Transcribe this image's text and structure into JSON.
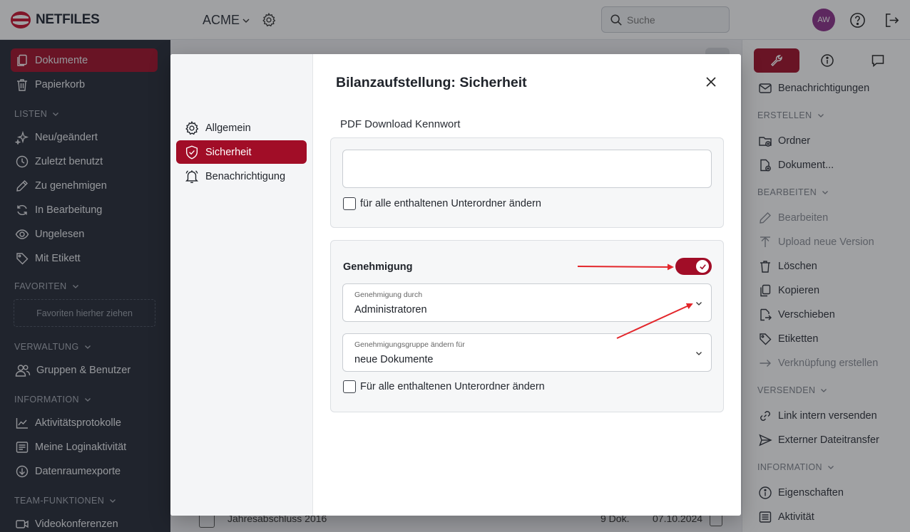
{
  "topbar": {
    "logo_text": "NETFILES",
    "workspace": "ACME",
    "search_placeholder": "Suche",
    "avatar_initials": "AW"
  },
  "sidebar": {
    "items_top": [
      {
        "label": "Dokumente",
        "icon": "documents-icon",
        "active": true
      },
      {
        "label": "Papierkorb",
        "icon": "trash-icon"
      }
    ],
    "section_lists": "LISTEN",
    "lists": [
      {
        "label": "Neu/geändert",
        "icon": "sparkle-icon"
      },
      {
        "label": "Zuletzt benutzt",
        "icon": "clock-icon"
      },
      {
        "label": "Zu genehmigen",
        "icon": "pencil-icon"
      },
      {
        "label": "In Bearbeitung",
        "icon": "refresh-icon"
      },
      {
        "label": "Ungelesen",
        "icon": "eye-icon"
      },
      {
        "label": "Mit Etikett",
        "icon": "tag-icon"
      }
    ],
    "section_favorites": "FAVORITEN",
    "favorites_drop": "Favoriten hierher ziehen",
    "section_admin": "VERWALTUNG",
    "admin": [
      {
        "label": "Gruppen & Benutzer",
        "icon": "users-icon"
      }
    ],
    "section_info": "INFORMATION",
    "info": [
      {
        "label": "Aktivitätsprotokolle",
        "icon": "chart-icon"
      },
      {
        "label": "Meine Loginaktivität",
        "icon": "list-icon"
      },
      {
        "label": "Datenraumexporte",
        "icon": "download-icon"
      }
    ],
    "section_team": "TEAM-FUNKTIONEN",
    "team": [
      {
        "label": "Videokonferenzen",
        "icon": "video-icon"
      }
    ]
  },
  "background_row": {
    "name": "Jahresabschluss 2016",
    "count": "9 Dok.",
    "date": "07.10.2024"
  },
  "rightbar": {
    "top_item": "Benachrichtigungen",
    "section_create": "ERSTELLEN",
    "create": [
      "Ordner",
      "Dokument..."
    ],
    "section_edit": "BEARBEITEN",
    "edit": [
      {
        "label": "Bearbeiten",
        "disabled": true
      },
      {
        "label": "Upload neue Version",
        "disabled": true
      },
      {
        "label": "Löschen"
      },
      {
        "label": "Kopieren"
      },
      {
        "label": "Verschieben"
      },
      {
        "label": "Etiketten"
      },
      {
        "label": "Verknüpfung erstellen",
        "disabled": true
      }
    ],
    "section_send": "VERSENDEN",
    "send": [
      "Link intern versenden",
      "Externer Dateitransfer"
    ],
    "section_info": "INFORMATION",
    "info": [
      "Eigenschaften",
      "Aktivität"
    ]
  },
  "modal": {
    "title": "Bilanzaufstellung: Sicherheit",
    "nav": [
      {
        "label": "Allgemein",
        "icon": "gear-icon"
      },
      {
        "label": "Sicherheit",
        "icon": "shield-icon",
        "active": true
      },
      {
        "label": "Benachrichtigung",
        "icon": "bell-icon"
      }
    ],
    "pdf_label": "PDF Download Kennwort",
    "pdf_password_value": "",
    "pdf_subfolders": "für alle enthaltenen Unterordner ändern",
    "approval_label": "Genehmigung",
    "approval_enabled": true,
    "approval_by_label": "Genehmigung durch",
    "approval_by_value": "Administratoren",
    "approval_group_label": "Genehmigungsgruppe ändern für",
    "approval_group_value": "neue Dokumente",
    "approval_subfolders": "Für alle enthaltenen Unterordner ändern"
  },
  "colors": {
    "accent": "#a10d27",
    "sidebar_bg": "#232834",
    "avatar": "#8c2f8a",
    "annotation_arrow": "#e3262b"
  }
}
